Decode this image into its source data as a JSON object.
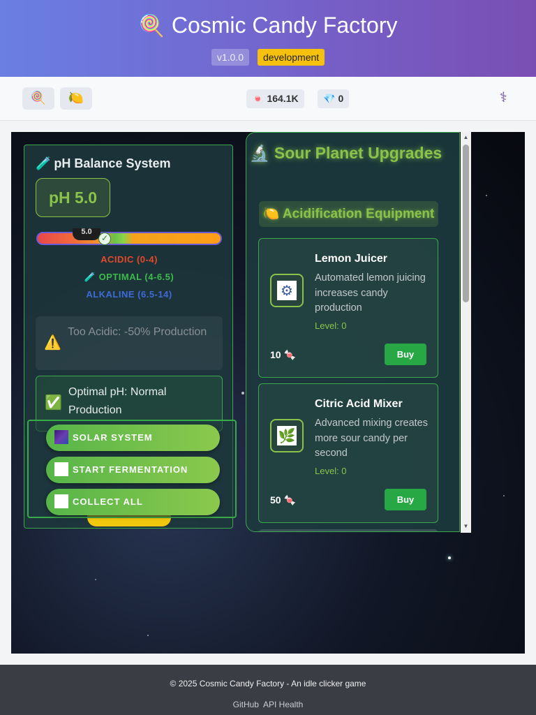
{
  "header": {
    "title_emoji": "🍭",
    "title": "Cosmic Candy Factory",
    "version": "v1.0.0",
    "environment": "development"
  },
  "toolbar": {
    "buttons": [
      {
        "icon": "lollipop-icon",
        "glyph": "🍭"
      },
      {
        "icon": "lemon-icon",
        "glyph": "🍋"
      }
    ],
    "candy_icon": "🍬",
    "candy_count": "164.1K",
    "gem_icon": "💎",
    "gem_count": "0",
    "settings_glyph": "⚕"
  },
  "ph_panel": {
    "title_emoji": "🧪",
    "title": "pH Balance System",
    "value_label": "pH 5.0",
    "marker_label": "5.0",
    "ph_value": 5.0,
    "legend": {
      "acidic": "ACIDIC (0-4)",
      "optimal_emoji": "🧪",
      "optimal": "OPTIMAL (4-6.5)",
      "alkaline": "ALKALINE (6.5-14)"
    },
    "status_acidic": {
      "emoji": "⚠️",
      "text": "Too Acidic: -50% Production"
    },
    "status_optimal": {
      "emoji": "✅",
      "text": "Optimal pH: Normal Production"
    }
  },
  "actions": {
    "solar_system": "SOLAR SYSTEM",
    "start_fermentation": "START FERMENTATION",
    "collect_all": "COLLECT ALL"
  },
  "upgrades": {
    "title_emoji": "🔬",
    "title": "Sour Planet Upgrades",
    "section_emoji": "🍋",
    "section": "Acidification Equipment",
    "cards": [
      {
        "name": "Lemon Juicer",
        "description": "Automated lemon juicing increases candy production",
        "level": "Level: 0",
        "cost": "10",
        "cost_emoji": "🍬",
        "buy": "Buy",
        "icon": "gear-icon",
        "glyph": "⚙"
      },
      {
        "name": "Citric Acid Mixer",
        "description": "Advanced mixing creates more sour candy per second",
        "level": "Level: 0",
        "cost": "50",
        "cost_emoji": "🍬",
        "buy": "Buy",
        "icon": "leaf-orb-icon",
        "glyph": "🌿"
      }
    ]
  },
  "footer": {
    "copyright": "© 2025 Cosmic Candy Factory - An idle clicker game",
    "link_github": "GitHub",
    "link_health": "API Health"
  },
  "colors": {
    "accent_green": "#8bc34a",
    "buy_green": "#28a745",
    "header_gradient_start": "#6a7fe3",
    "header_gradient_end": "#7a4fb3",
    "badge_env": "#f6c00f"
  }
}
